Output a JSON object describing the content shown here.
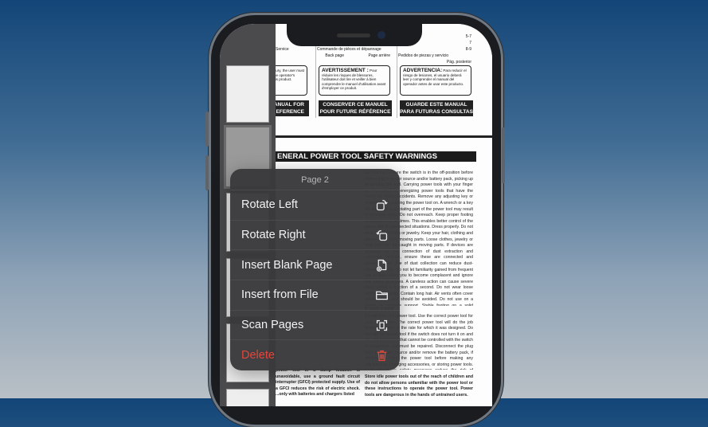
{
  "document": {
    "toc": [
      {
        "lines": [
          "Service",
          "Back page"
        ]
      },
      {
        "lines": [
          "Commande de pièces et dépannage",
          "Page arrière"
        ]
      },
      {
        "lines": [
          "5-7",
          "7",
          "8-9",
          "Pedidos de piezas y servicio",
          "Pág. posterior"
        ]
      }
    ],
    "warnings": [
      {
        "title": "",
        "text": "To reduce the risk of injury, the user must read and understand the operator's manual before using this product."
      },
      {
        "title": "AVERTISSEMENT :",
        "text": "Pour réduire les risques de blessures, l'utilisateur doit lire et veiller à bien comprendre le manuel d'utilisation avant d'employer ce produit."
      },
      {
        "title": "ADVERTENCIA:",
        "text": "Para reducir el riesgo de lesiones, el usuario deberá leer y comprender el manual del operador antes de usar este producto."
      }
    ],
    "keep_labels": [
      "MANUAL FOR\nEFERENCE",
      "CONSERVER CE MANUEL\nPOUR FUTURE RÉFÉRENCE",
      "GUARDE ESTE MANUAL\nPARA FUTURAS CONSULTAS"
    ],
    "heading": "ENERAL POWER TOOL SAFETY WARNINGS",
    "right_column": "nal starting. Ensure the switch is in the off-position before connecting to power source and/or battery pack, picking up or carrying the tool. Carrying power tools with your finger on the switch or energizing power tools that have the switch on invites accidents. Remove any adjusting key or wrench before turning the power tool on. A wrench or a key left attached to a rotating part of the power tool may result in personal injury. Do not overreach. Keep proper footing and balance at all times. This enables better control of the power tool in unexpected situations. Dress properly. Do not wear loose clothing or jewelry. Keep your hair, clothing and gloves away from moving parts. Loose clothes, jewelry or long hair can be caught in moving parts. If devices are provided for the connection of dust extraction and collection facilities, ensure these are connected and properly used. Use of dust collection can reduce dust-related hazards. Do not let familiarity gained from frequent use of tools allow you to become complacent and ignore tool safety principles. A careless action can cause severe injury within a fraction of a second. Do not wear loose clothing or jewelry. Contain long hair. Air vents often cover moving parts and should be avoided. Do not use on a ladder or unstable support. Stable footing on a solid surface enables better control of the power tool in unexpected situations.",
    "subheading": "E AND CARE",
    "right_column_2": "Do not force the power tool. Use the correct power tool for your application. The correct power tool will do the job better and safer at the rate for which it was designed. Do not use the power tool if the switch does not turn it on and off. Any power tool that cannot be controlled with the switch is dangerous and must be repaired. Disconnect the plug from the power source and/or remove the battery pack, if detachable, from the power tool before making any adjustments, changing accessories, or storing power tools. Such preventive safety measures reduce the risk of starting the power tool accidentally.",
    "bullet": "Store idle power tools out of the reach of children and do not allow persons unfamiliar with the power tool or these instructions to operate the power tool. Power tools are dangerous in the hands of untrained users.",
    "left_bottom": "power tool in a damp location is unavoidable, use a ground fault circuit interrupter (GFCI) protected supply. Use of a GFCI reduces the risk of electric shock. ...only with batteries and chargers listed"
  },
  "menu": {
    "title": "Page 2",
    "items": [
      {
        "label": "Rotate Left",
        "icon": "rotate-left-icon"
      },
      {
        "label": "Rotate Right",
        "icon": "rotate-right-icon"
      },
      {
        "label": "Insert Blank Page",
        "icon": "insert-page-icon"
      },
      {
        "label": "Insert from File",
        "icon": "folder-icon"
      },
      {
        "label": "Scan Pages",
        "icon": "scan-icon"
      },
      {
        "label": "Delete",
        "icon": "trash-icon",
        "destructive": true
      }
    ]
  },
  "colors": {
    "destructive": "#e5453a",
    "menu_bg": "#3a3a3c"
  }
}
